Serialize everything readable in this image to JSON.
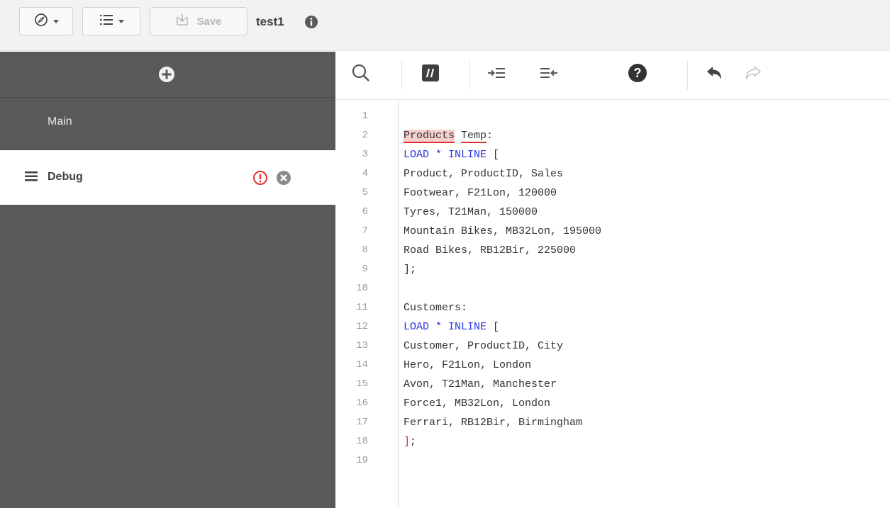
{
  "toolbar": {
    "save_label": "Save",
    "app_title": "test1"
  },
  "sidebar": {
    "sections": [
      {
        "label": "Main",
        "active": false
      },
      {
        "label": "Debug",
        "active": true,
        "has_error": true
      }
    ]
  },
  "editor": {
    "tools": [
      "search-icon",
      "comment-icon",
      "indent-icon",
      "outdent-icon",
      "help-icon",
      "undo-icon",
      "redo-icon"
    ],
    "line_numbers": [
      "1",
      "2",
      "3",
      "4",
      "5",
      "6",
      "7",
      "8",
      "9",
      "10",
      "11",
      "12",
      "13",
      "14",
      "15",
      "16",
      "17",
      "18",
      "19"
    ],
    "lines": {
      "l2_a": "Products",
      "l2_b": "Temp",
      "l2_c": ":",
      "l3_kw": "LOAD * INLINE",
      "l3_rest": " [",
      "l4": "Product, ProductID, Sales",
      "l5": "Footwear, F21Lon, 120000",
      "l6": "Tyres, T21Man, 150000",
      "l7": "Mountain Bikes, MB32Lon, 195000",
      "l8": "Road Bikes, RB12Bir, 225000",
      "l9": "];",
      "l11": "Customers:",
      "l12_kw": "LOAD * INLINE",
      "l12_rest": " [",
      "l13": "Customer, ProductID, City",
      "l14": "Hero, F21Lon, London",
      "l15": "Avon, T21Man, Manchester",
      "l16": "Force1, MB32Lon, London",
      "l17": "Ferrari, RB12Bir, Birmingham",
      "l18_a": "]",
      "l18_b": ";"
    }
  },
  "colors": {
    "sidebar_bg": "#595959",
    "keyword": "#2a34e8",
    "error": "#e03030",
    "error_highlight": "#f7cfcf"
  }
}
